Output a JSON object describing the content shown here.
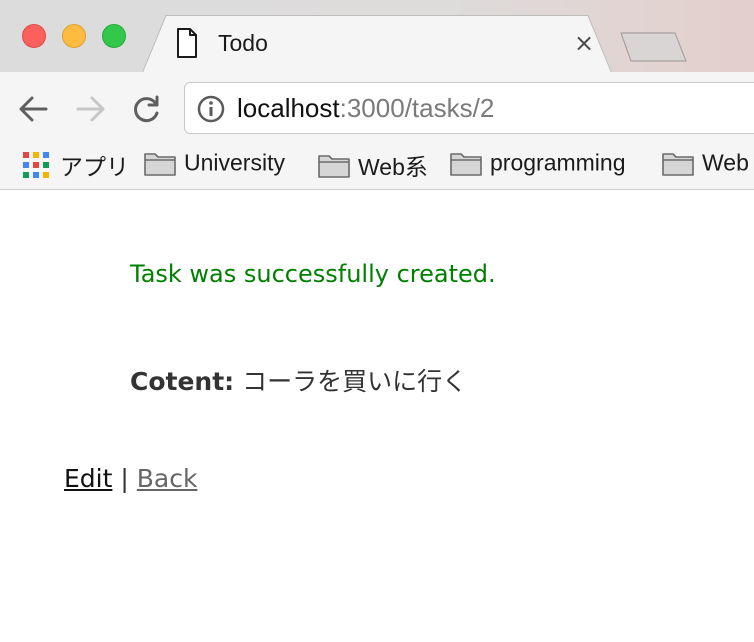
{
  "browser": {
    "tab": {
      "title": "Todo",
      "close_glyph": "×"
    },
    "address_bar": {
      "host": "localhost",
      "path": ":3000/tasks/2"
    },
    "bookmarks": [
      {
        "label": "アプリ",
        "icon": "apps-grid-icon"
      },
      {
        "label": "University",
        "icon": "folder-icon"
      },
      {
        "label": "Web系",
        "icon": "folder-icon"
      },
      {
        "label": "programming",
        "icon": "folder-icon"
      },
      {
        "label": "Web",
        "icon": "folder-icon"
      }
    ],
    "colors": {
      "close": "#fc605c",
      "minimize": "#fdbc40",
      "maximize": "#34c84a"
    }
  },
  "page": {
    "notice": "Task was successfully created.",
    "notice_color": "#008000",
    "field_label": "Cotent:",
    "field_value": "コーラを買いに行く",
    "links": {
      "edit": "Edit",
      "separator": "|",
      "back": "Back"
    }
  }
}
